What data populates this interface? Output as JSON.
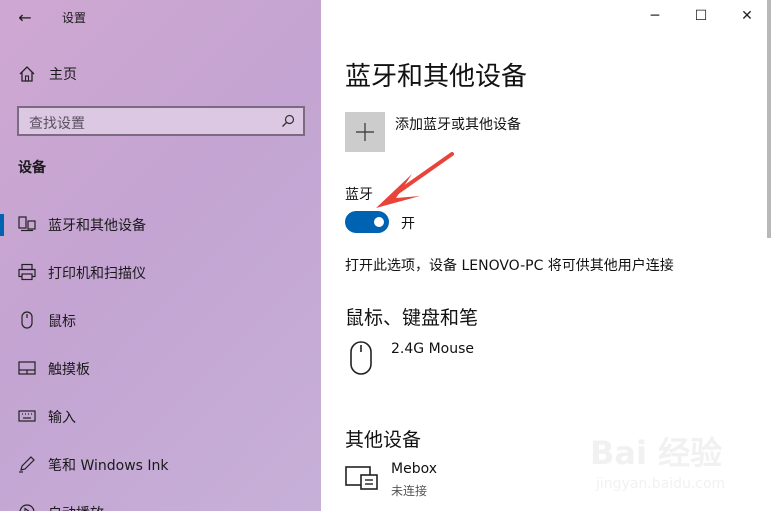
{
  "window": {
    "title": "设置",
    "back_glyph": "←",
    "minimize_glyph": "─",
    "maximize_glyph": "☐",
    "close_glyph": "✕"
  },
  "sidebar": {
    "home_label": "主页",
    "search_placeholder": "查找设置",
    "section_title": "设备",
    "items": [
      {
        "label": "蓝牙和其他设备",
        "icon": "bluetooth-devices-icon",
        "selected": true
      },
      {
        "label": "打印机和扫描仪",
        "icon": "printer-icon",
        "selected": false
      },
      {
        "label": "鼠标",
        "icon": "mouse-icon",
        "selected": false
      },
      {
        "label": "触摸板",
        "icon": "touchpad-icon",
        "selected": false
      },
      {
        "label": "输入",
        "icon": "keyboard-icon",
        "selected": false
      },
      {
        "label": "笔和 Windows Ink",
        "icon": "pen-icon",
        "selected": false
      },
      {
        "label": "自动播放",
        "icon": "autoplay-icon",
        "selected": false
      }
    ]
  },
  "main": {
    "title": "蓝牙和其他设备",
    "add_device_label": "添加蓝牙或其他设备",
    "bluetooth": {
      "label": "蓝牙",
      "state_label": "开",
      "on": true,
      "description": "打开此选项，设备 LENOVO-PC 将可供其他用户连接"
    },
    "mouse_section": {
      "title": "鼠标、键盘和笔",
      "devices": [
        {
          "name": "2.4G Mouse",
          "status": "",
          "icon": "mouse-icon"
        }
      ]
    },
    "other_section": {
      "title": "其他设备",
      "devices": [
        {
          "name": "Mebox",
          "status": "未连接",
          "icon": "display-device-icon"
        }
      ]
    }
  },
  "watermark": {
    "main": "Bai 经验",
    "sub": "jingyan.baidu.com"
  },
  "colors": {
    "accent": "#0063b1",
    "arrow": "#e8443a"
  }
}
